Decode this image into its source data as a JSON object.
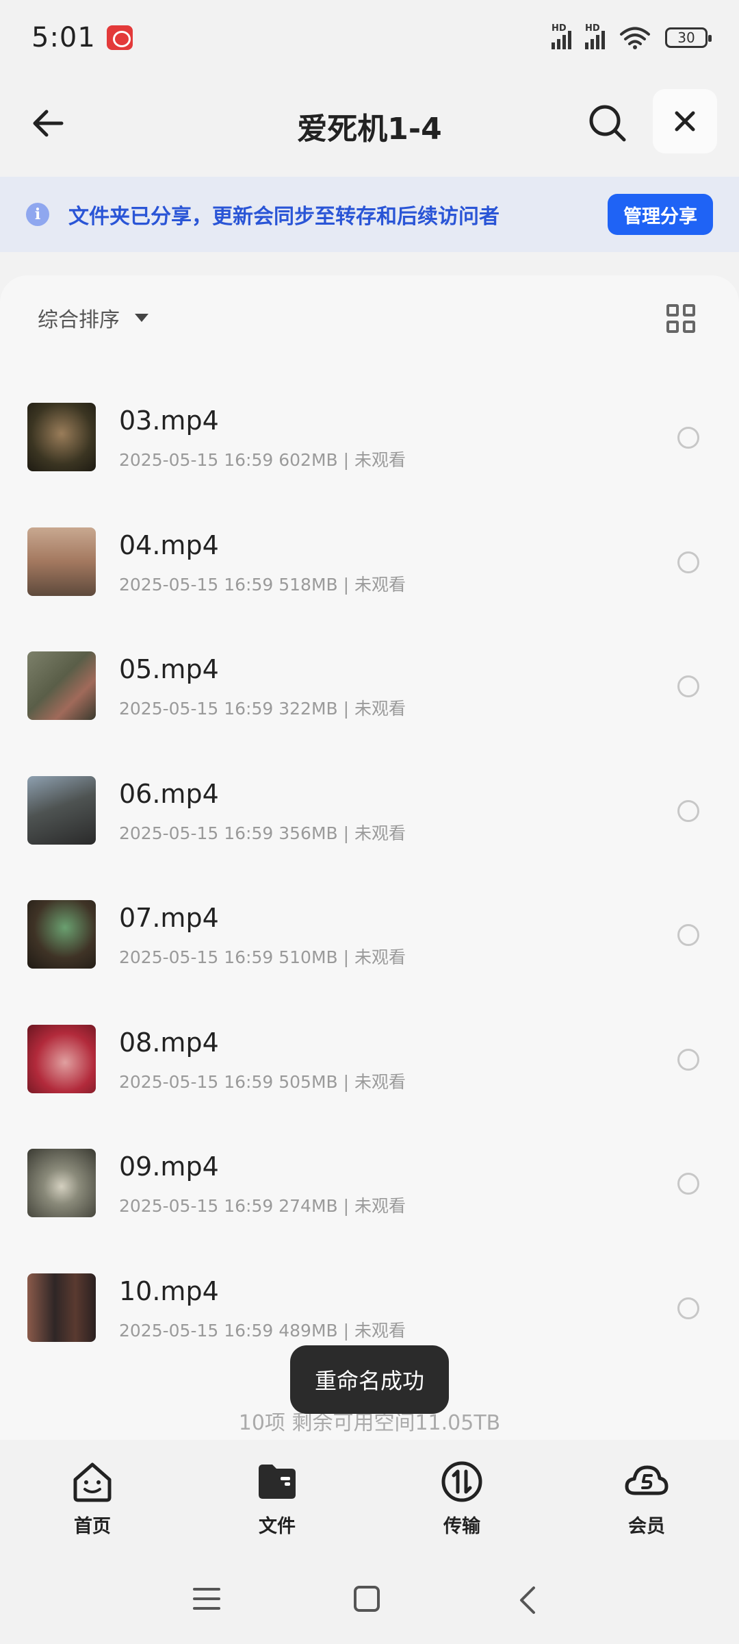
{
  "status_bar": {
    "time": "5:01",
    "signal1_label": "HD",
    "signal2_label": "HD",
    "wifi_icon": "wifi-icon",
    "battery": "30"
  },
  "header": {
    "title": "爱死机1-4",
    "back_icon": "back-arrow-icon",
    "search_icon": "search-icon",
    "close_icon": "close-icon"
  },
  "banner": {
    "text": "文件夹已分享，更新会同步至转存和后续访问者",
    "button": "管理分享",
    "icon": "info-icon"
  },
  "sort": {
    "label": "综合排序",
    "view_icon": "grid-view-icon"
  },
  "files": [
    {
      "name": "03.mp4",
      "meta": "2025-05-15 16:59  602MB | 未观看",
      "thumb_color": "#3b3522"
    },
    {
      "name": "04.mp4",
      "meta": "2025-05-15 16:59  518MB | 未观看",
      "thumb_color": "#a3785f"
    },
    {
      "name": "05.mp4",
      "meta": "2025-05-15 16:59  322MB | 未观看",
      "thumb_color": "#5a5e48"
    },
    {
      "name": "06.mp4",
      "meta": "2025-05-15 16:59  356MB | 未观看",
      "thumb_color": "#4e5352"
    },
    {
      "name": "07.mp4",
      "meta": "2025-05-15 16:59  510MB | 未观看",
      "thumb_color": "#3f3326"
    },
    {
      "name": "08.mp4",
      "meta": "2025-05-15 16:59  505MB | 未观看",
      "thumb_color": "#b22a3b"
    },
    {
      "name": "09.mp4",
      "meta": "2025-05-15 16:59  274MB | 未观看",
      "thumb_color": "#6a6a5e"
    },
    {
      "name": "10.mp4",
      "meta": "2025-05-15 16:59  489MB | 未观看",
      "thumb_color": "#2f2626"
    }
  ],
  "summary": "10项 剩余可用空间11.05TB",
  "toast": "重命名成功",
  "nav": [
    {
      "label": "首页",
      "icon": "home-smile-icon"
    },
    {
      "label": "文件",
      "icon": "folder-icon"
    },
    {
      "label": "传输",
      "icon": "transfer-icon"
    },
    {
      "label": "会员",
      "icon": "vip-cloud-icon"
    }
  ],
  "system_nav": [
    "menu-icon",
    "home-square-icon",
    "back-chevron-icon"
  ]
}
